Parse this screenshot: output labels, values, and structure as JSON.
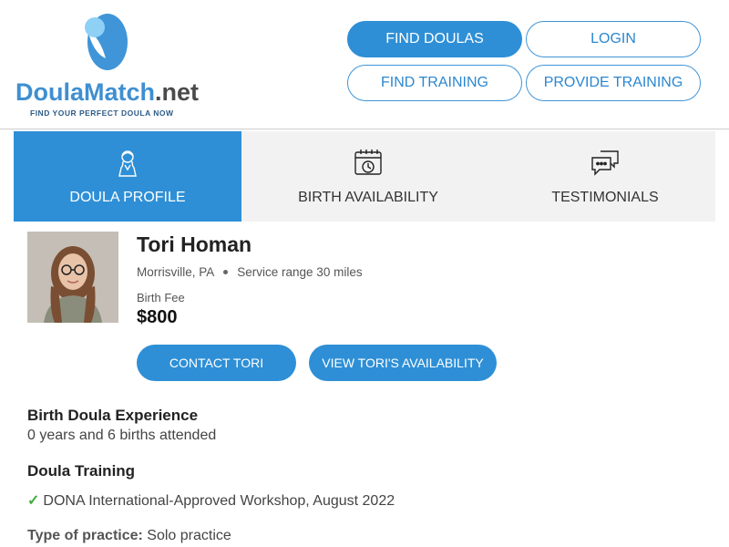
{
  "logo": {
    "brand_main": "DoulaMatch",
    "brand_suffix": ".net",
    "tagline": "FIND YOUR PERFECT DOULA NOW"
  },
  "nav": {
    "find_doulas": "FIND DOULAS",
    "login": "LOGIN",
    "find_training": "FIND TRAINING",
    "provide_training": "PROVIDE TRAINING"
  },
  "tabs": [
    {
      "label": "DOULA PROFILE",
      "icon": "person-icon",
      "active": true
    },
    {
      "label": "BIRTH AVAILABILITY",
      "icon": "calendar-clock-icon",
      "active": false
    },
    {
      "label": "TESTIMONIALS",
      "icon": "chat-bubbles-icon",
      "active": false
    }
  ],
  "profile": {
    "name": "Tori Homan",
    "location": "Morrisville, PA",
    "service_range": "Service range 30 miles",
    "fee_label": "Birth Fee",
    "fee_value": "$800",
    "contact_button": "CONTACT TORI",
    "availability_button": "VIEW TORI'S AVAILABILITY"
  },
  "experience": {
    "title": "Birth Doula Experience",
    "text": "0 years and 6 births attended"
  },
  "training": {
    "title": "Doula Training",
    "items": [
      "DONA International-Approved Workshop, August 2022"
    ]
  },
  "practice": {
    "label": "Type of practice:",
    "value": "Solo practice"
  },
  "colors": {
    "accent": "#2e8fd6",
    "tab_bg": "#f2f2f2",
    "check": "#3fae3f"
  }
}
